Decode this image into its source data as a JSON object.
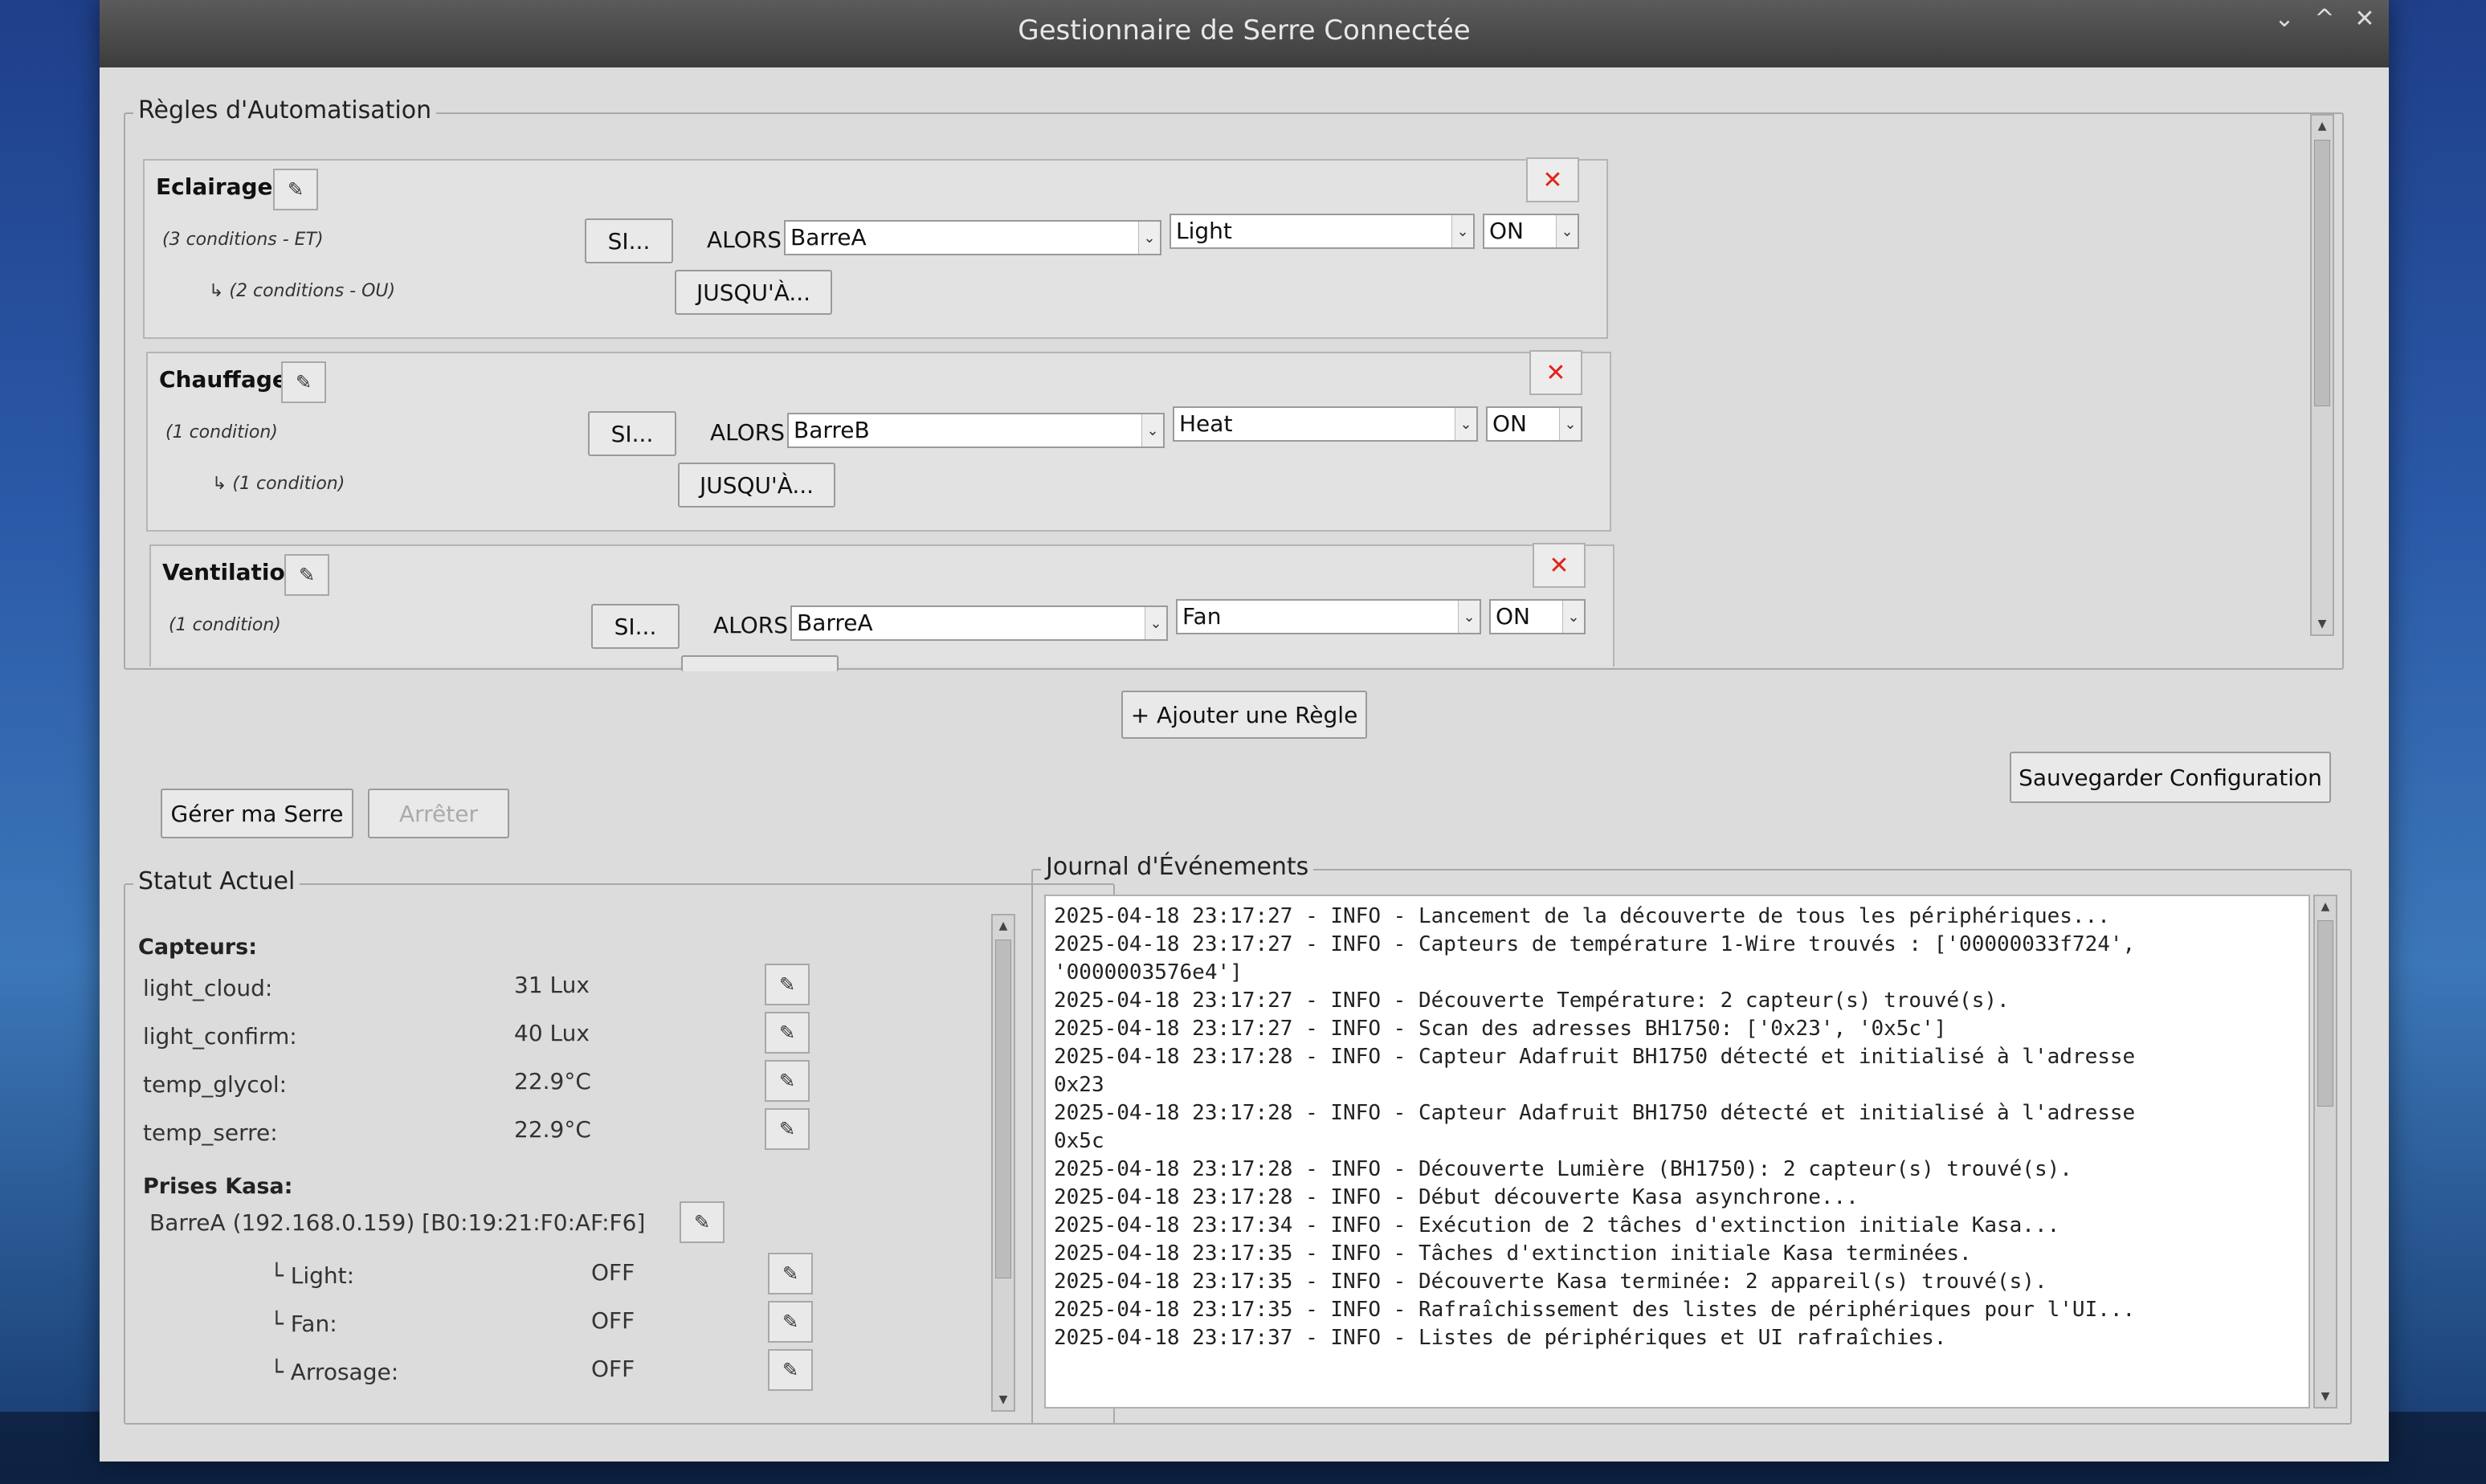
{
  "window": {
    "title": "Gestionnaire de Serre Connectée"
  },
  "automation": {
    "legend": "Règles d'Automatisation",
    "add_rule_label": "+ Ajouter une Règle",
    "rules": [
      {
        "name": "Eclairage",
        "conditions": "(3 conditions - ET)",
        "until_conditions": "↳  (2 conditions - OU)",
        "si_label": "SI...",
        "alors_label": "ALORS",
        "device": "BarreA",
        "outlet": "Light",
        "state": "ON",
        "until_label": "JUSQU'À..."
      },
      {
        "name": "Chauffage",
        "conditions": "(1 condition)",
        "until_conditions": "↳  (1 condition)",
        "si_label": "SI...",
        "alors_label": "ALORS",
        "device": "BarreB",
        "outlet": "Heat",
        "state": "ON",
        "until_label": "JUSQU'À..."
      },
      {
        "name": "Ventilation",
        "conditions": "(1 condition)",
        "si_label": "SI...",
        "alors_label": "ALORS",
        "device": "BarreA",
        "outlet": "Fan",
        "state": "ON"
      }
    ]
  },
  "controls": {
    "manage_label": "Gérer ma Serre",
    "stop_label": "Arrêter",
    "save_label": "Sauvegarder Configuration"
  },
  "status": {
    "legend": "Statut Actuel",
    "sensors_header": "Capteurs:",
    "sensors": [
      {
        "name": "light_cloud:",
        "value": "31 Lux"
      },
      {
        "name": "light_confirm:",
        "value": "40 Lux"
      },
      {
        "name": "temp_glycol:",
        "value": "22.9°C"
      },
      {
        "name": "temp_serre:",
        "value": "22.9°C"
      }
    ],
    "plugs_header": "Prises Kasa:",
    "plug_device": "BarreA (192.168.0.159) [B0:19:21:F0:AF:F6]",
    "outlets": [
      {
        "name": "└ Light:",
        "value": "OFF"
      },
      {
        "name": "└ Fan:",
        "value": "OFF"
      },
      {
        "name": "└ Arrosage:",
        "value": "OFF"
      }
    ]
  },
  "log": {
    "legend": "Journal d'Événements",
    "lines": [
      "2025-04-18 23:17:27 - INFO - Lancement de la découverte de tous les périphériques...",
      "2025-04-18 23:17:27 - INFO - Capteurs de température 1-Wire trouvés : ['00000033f724',",
      "'0000003576e4']",
      "2025-04-18 23:17:27 - INFO - Découverte Température: 2 capteur(s) trouvé(s).",
      "2025-04-18 23:17:27 - INFO - Scan des adresses BH1750: ['0x23', '0x5c']",
      "2025-04-18 23:17:28 - INFO - Capteur Adafruit BH1750 détecté et initialisé à l'adresse",
      "0x23",
      "2025-04-18 23:17:28 - INFO - Capteur Adafruit BH1750 détecté et initialisé à l'adresse",
      "0x5c",
      "2025-04-18 23:17:28 - INFO - Découverte Lumière (BH1750): 2 capteur(s) trouvé(s).",
      "2025-04-18 23:17:28 - INFO - Début découverte Kasa asynchrone...",
      "2025-04-18 23:17:34 - INFO - Exécution de 2 tâches d'extinction initiale Kasa...",
      "2025-04-18 23:17:35 - INFO - Tâches d'extinction initiale Kasa terminées.",
      "2025-04-18 23:17:35 - INFO - Découverte Kasa terminée: 2 appareil(s) trouvé(s).",
      "2025-04-18 23:17:35 - INFO - Rafraîchissement des listes de périphériques pour l'UI...",
      "2025-04-18 23:17:37 - INFO - Listes de périphériques et UI rafraîchies."
    ]
  },
  "icons": {
    "edit": "✎",
    "close": "✕",
    "dropdown": "⌄",
    "minimize": "⌄",
    "maximize": "^",
    "window_close": "✕",
    "scroll_up": "▲",
    "scroll_down": "▼"
  },
  "colors": {
    "close_red": "#e2231a",
    "titlebar": "#4a4a4a",
    "window_bg": "#dcdcdc"
  }
}
